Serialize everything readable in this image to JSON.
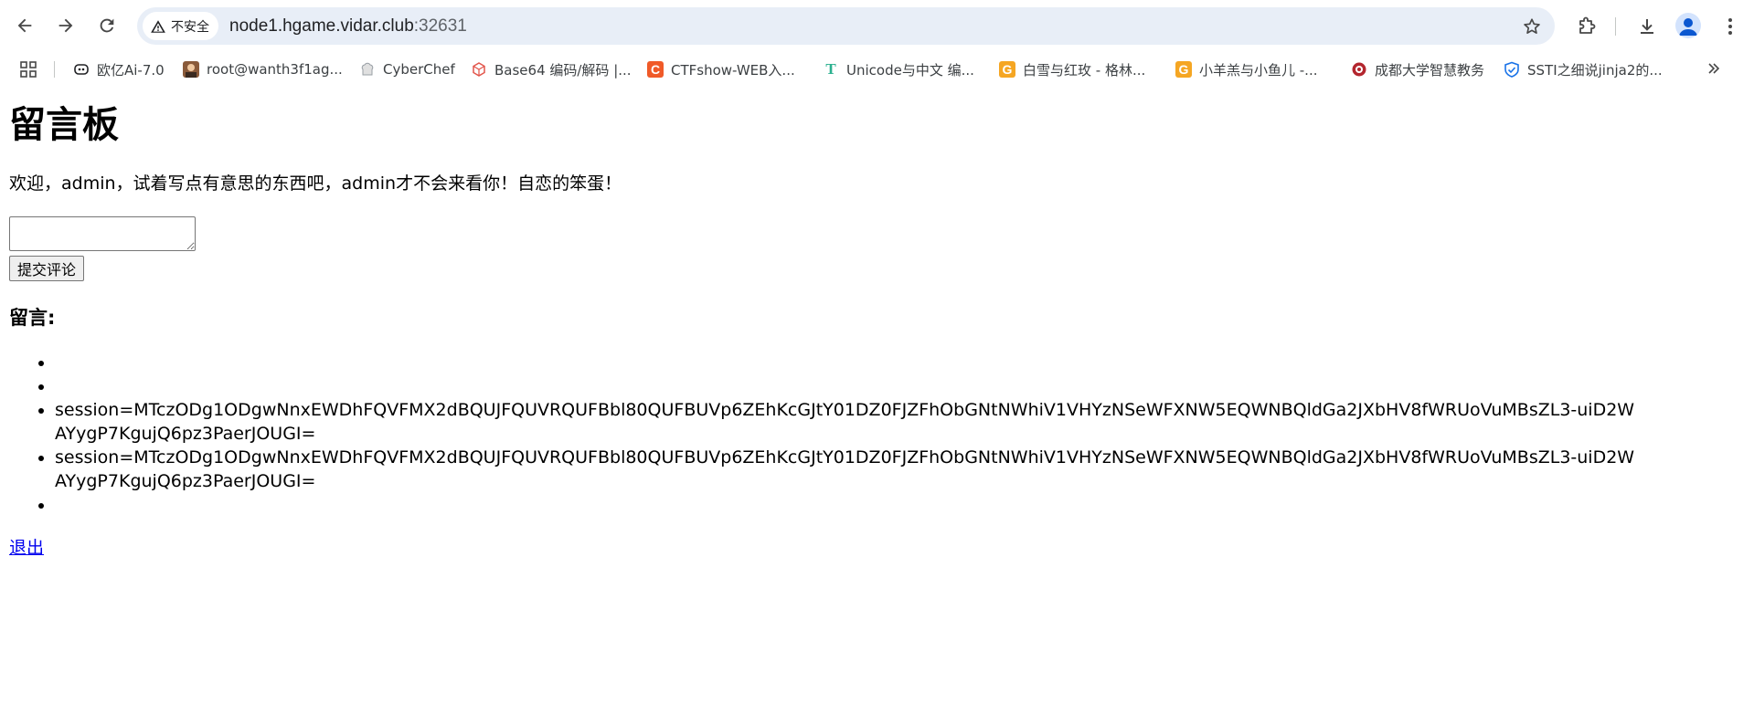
{
  "browser": {
    "security_label": "不安全",
    "url_host": "node1.hgame.vidar.club",
    "url_port": ":32631",
    "bookmarks": [
      {
        "label": "欧亿Ai-7.0",
        "icon": "discord-icon"
      },
      {
        "label": "root@wanth3f1ag...",
        "icon": "avatar-icon"
      },
      {
        "label": "CyberChef",
        "icon": "chef-hat-icon"
      },
      {
        "label": "Base64 编码/解码 |...",
        "icon": "cube-icon"
      },
      {
        "label": "CTFshow-WEB入...",
        "icon": "c-logo-icon"
      },
      {
        "label": "Unicode与中文 编...",
        "icon": "t-logo-icon"
      },
      {
        "label": "白雪与红玫 - 格林...",
        "icon": "g-logo-icon"
      },
      {
        "label": "小羊羔与小鱼儿 -...",
        "icon": "g-logo-icon"
      },
      {
        "label": "成都大学智慧教务",
        "icon": "university-seal-icon"
      },
      {
        "label": "SSTI之细说jinja2的...",
        "icon": "shield-icon"
      }
    ]
  },
  "page": {
    "title": "留言板",
    "welcome": "欢迎，admin，试着写点有意思的东西吧，admin才不会来看你！自恋的笨蛋！",
    "comment_input_value": "",
    "submit_label": "提交评论",
    "comments_heading": "留言:",
    "comments": [
      "",
      "",
      "session=MTczODg1ODgwNnxEWDhFQVFMX2dBQUJFQUVRQUFBbl80QUFBUVp6ZEhKcGJtY01DZ0FJZFhObGNtNWhiV1VHYzNSeWFXNW5EQWNBQldGa2JXbHV8fWRUoVuMBsZL3-uiD2WAYygP7KgujQ6pz3PaerJOUGI=",
      "session=MTczODg1ODgwNnxEWDhFQVFMX2dBQUJFQUVRQUFBbl80QUFBUVp6ZEhKcGJtY01DZ0FJZFhObGNtNWhiV1VHYzNSeWFXNW5EQWNBQldGa2JXbHV8fWRUoVuMBsZL3-uiD2WAYygP7KgujQ6pz3PaerJOUGI=",
      ""
    ],
    "logout_label": "退出"
  },
  "colors": {
    "omnibox_bg": "#e8eef7",
    "link": "#0000ee",
    "icon": "#474747"
  }
}
